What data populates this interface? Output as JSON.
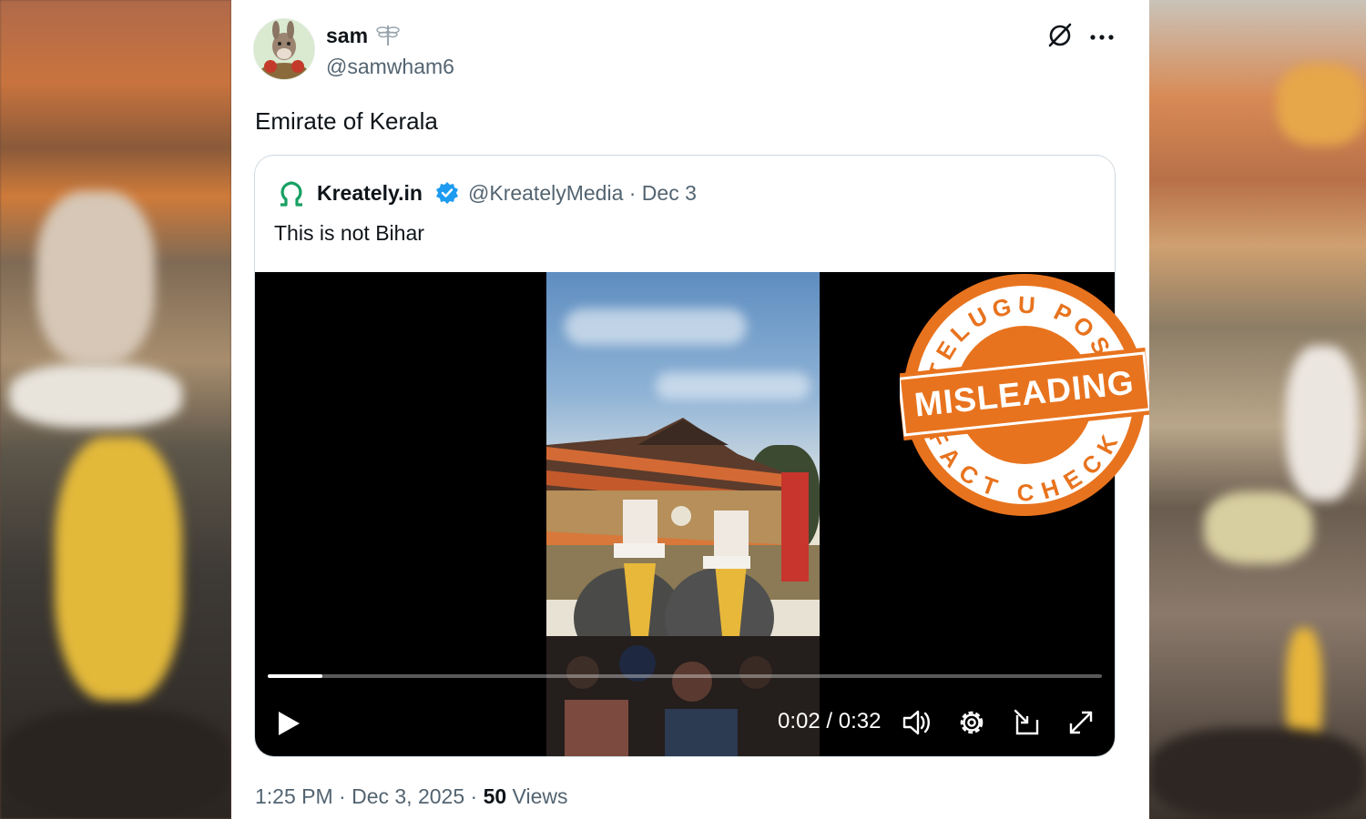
{
  "tweet": {
    "display_name": "sam",
    "handle": "@samwham6",
    "text": "Emirate of Kerala",
    "timestamp": "1:25 PM · Dec 3, 2025 · ",
    "views_count": "50",
    "views_label": " Views"
  },
  "quoted": {
    "name": "Kreately.in",
    "handle_date": "@KreatelyMedia · Dec 3",
    "text": "This is not Bihar",
    "verified_color": "#1d9bf0",
    "logo_color": "#17a062"
  },
  "video": {
    "time": "0:02 / 0:32",
    "progress": 0.065,
    "icons": [
      "play-icon",
      "volume-icon",
      "settings-gear-icon",
      "pip-icon",
      "fullscreen-icon"
    ]
  },
  "stamp": {
    "top_text": "TELUGU POST",
    "main_text": "MISLEADING",
    "bottom_text": "FACT CHECK",
    "color": "#e8731e"
  },
  "icons": {
    "grok": "grok-icon",
    "more": "more-icon"
  }
}
